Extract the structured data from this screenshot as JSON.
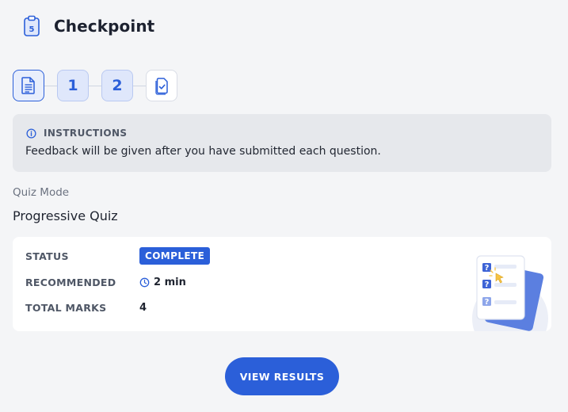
{
  "header": {
    "icon": "clipboard-number-icon",
    "icon_number": "5",
    "title": "Checkpoint"
  },
  "stepper": {
    "steps": [
      {
        "type": "instructions",
        "icon": "document-icon"
      },
      {
        "type": "question",
        "label": "1"
      },
      {
        "type": "question",
        "label": "2"
      },
      {
        "type": "review",
        "icon": "clipboard-check-icon"
      }
    ]
  },
  "instructions": {
    "heading": "INSTRUCTIONS",
    "icon": "info-icon",
    "text": "Feedback will be given after you have submitted each question."
  },
  "quiz": {
    "mode_label": "Quiz Mode",
    "mode_value": "Progressive Quiz"
  },
  "details": {
    "status_label": "STATUS",
    "status_value": "COMPLETE",
    "recommended_label": "RECOMMENDED",
    "recommended_value": "2 min",
    "total_marks_label": "TOTAL MARKS",
    "total_marks_value": "4"
  },
  "actions": {
    "view_results_label": "VIEW RESULTS"
  },
  "colors": {
    "accent": "#2b5fd9",
    "background": "#f4f5f7",
    "card": "#ffffff",
    "instructions_bg": "#e6e8ec"
  }
}
